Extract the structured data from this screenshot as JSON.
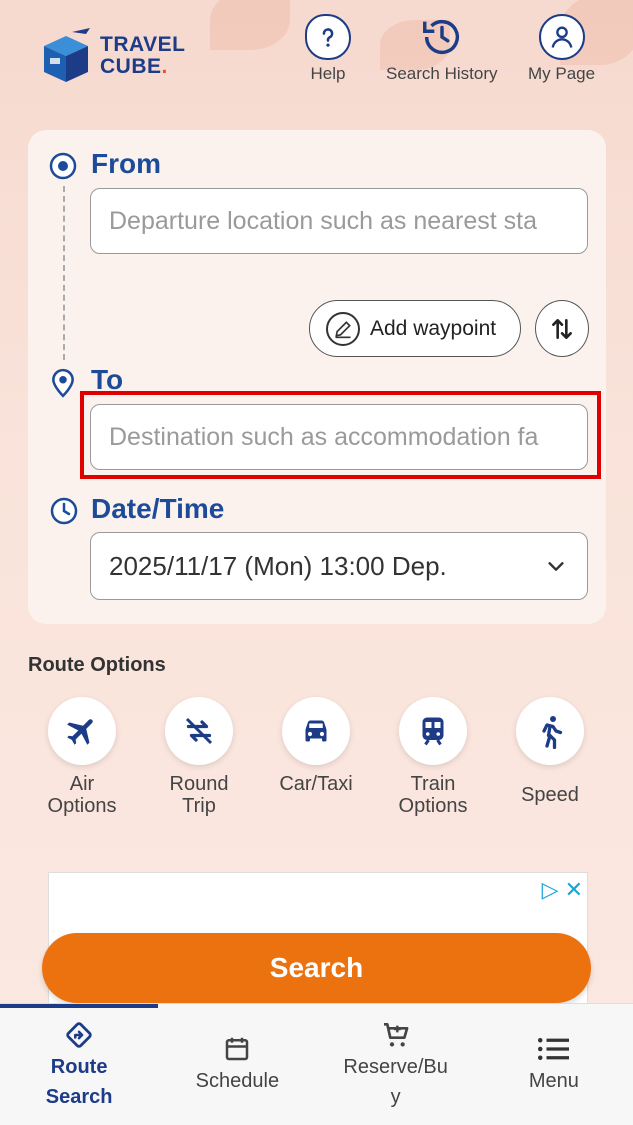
{
  "header": {
    "logo_line1": "TRAVEL",
    "logo_line2": "CUBE",
    "help_label": "Help",
    "history_label": "Search History",
    "mypage_label": "My Page"
  },
  "form": {
    "from_label": "From",
    "from_placeholder": "Departure location such as nearest sta",
    "add_waypoint_label": "Add waypoint",
    "to_label": "To",
    "to_placeholder": "Destination such as accommodation fa",
    "datetime_label": "Date/Time",
    "datetime_value": "2025/11/17 (Mon) 13:00 Dep."
  },
  "route_options": {
    "title": "Route Options",
    "items": [
      {
        "line1": "Air",
        "line2": "Options",
        "icon": "airplane-icon"
      },
      {
        "line1": "Round",
        "line2": "Trip",
        "icon": "round-trip-icon"
      },
      {
        "line1": "Car/Taxi",
        "line2": "",
        "icon": "car-icon"
      },
      {
        "line1": "Train",
        "line2": "Options",
        "icon": "train-icon"
      },
      {
        "line1": "Speed",
        "line2": "",
        "icon": "running-person-icon"
      }
    ]
  },
  "search_button": "Search",
  "bottom_nav": {
    "route_line1": "Route",
    "route_line2": "Search",
    "schedule": "Schedule",
    "reserve_line1": "Reserve/Bu",
    "reserve_line2": "y",
    "menu": "Menu"
  },
  "colors": {
    "brand": "#1d3c87",
    "accent": "#ec720f",
    "highlight": "#e00000"
  }
}
